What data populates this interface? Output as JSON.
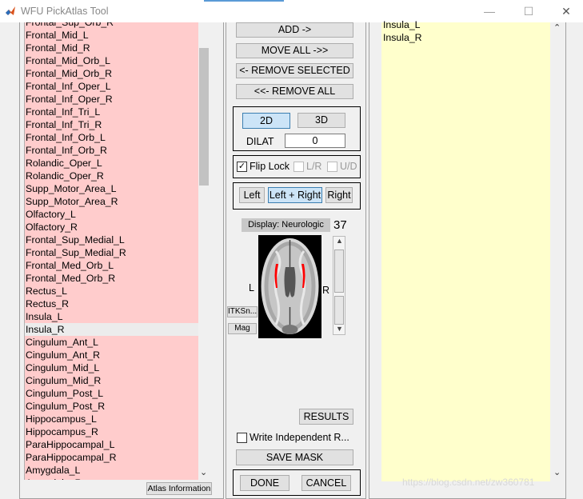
{
  "window": {
    "title": "WFU PickAtlas Tool",
    "minimize_glyph": "—",
    "maximize_glyph": "☐",
    "close_glyph": "✕"
  },
  "left_list": {
    "top_partial": "Frontal_Sup_Orb_R",
    "items": [
      "Frontal_Mid_L",
      "Frontal_Mid_R",
      "Frontal_Mid_Orb_L",
      "Frontal_Mid_Orb_R",
      "Frontal_Inf_Oper_L",
      "Frontal_Inf_Oper_R",
      "Frontal_Inf_Tri_L",
      "Frontal_Inf_Tri_R",
      "Frontal_Inf_Orb_L",
      "Frontal_Inf_Orb_R",
      "Rolandic_Oper_L",
      "Rolandic_Oper_R",
      "Supp_Motor_Area_L",
      "Supp_Motor_Area_R",
      "Olfactory_L",
      "Olfactory_R",
      "Frontal_Sup_Medial_L",
      "Frontal_Sup_Medial_R",
      "Frontal_Med_Orb_L",
      "Frontal_Med_Orb_R",
      "Rectus_L",
      "Rectus_R",
      "Insula_L",
      "Insula_R",
      "Cingulum_Ant_L",
      "Cingulum_Ant_R",
      "Cingulum_Mid_L",
      "Cingulum_Mid_R",
      "Cingulum_Post_L",
      "Cingulum_Post_R",
      "Hippocampus_L",
      "Hippocampus_R",
      "ParaHippocampal_L",
      "ParaHippocampal_R",
      "Amygdala_L",
      "Amygdala_R"
    ],
    "selected": "Insula_R",
    "background": "#ffcccc"
  },
  "atlas_info_button": "Atlas Information",
  "buttons": {
    "add": "ADD ->",
    "move_all": "MOVE ALL ->>",
    "remove_selected": "<- REMOVE SELECTED",
    "remove_all": "<<- REMOVE ALL"
  },
  "dimension": {
    "btn_2d": "2D",
    "btn_3d": "3D",
    "dilat_label": "DILAT",
    "dilat_value": "0",
    "active": "2D"
  },
  "flip": {
    "flip_lock": "Flip Lock",
    "flip_lock_checked": true,
    "lr": "L/R",
    "ud": "U/D"
  },
  "hemisphere": {
    "left": "Left",
    "left_right": "Left + Right",
    "right": "Right",
    "active": "Left + Right"
  },
  "display": {
    "label": "Display: Neurologic",
    "slice": "37",
    "left_marker": "L",
    "right_marker": "R",
    "itksnap": "ITKSn...",
    "mag": "Mag"
  },
  "results": "RESULTS",
  "write_independent": "Write Independent R...",
  "save_mask": "SAVE MASK",
  "done": "DONE",
  "cancel": "CANCEL",
  "right_list": {
    "items": [
      "Insula_L",
      "Insula_R"
    ],
    "background": "#ffffcc"
  },
  "watermark": "https://blog.csdn.net/zw360781"
}
